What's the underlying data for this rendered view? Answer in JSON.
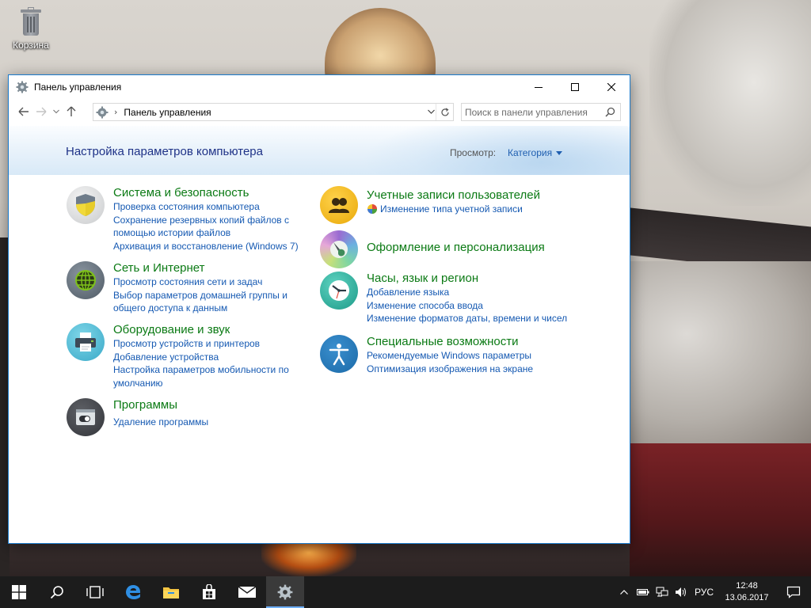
{
  "desktop": {
    "recycle_bin_label": "Корзина"
  },
  "window": {
    "title": "Панель управления",
    "address": {
      "crumb": "Панель управления",
      "separator": "›"
    },
    "search": {
      "placeholder": "Поиск в панели управления"
    },
    "banner": {
      "heading": "Настройка параметров компьютера",
      "view_label": "Просмотр:",
      "view_value": "Категория"
    },
    "categories": [
      {
        "title": "Система и безопасность",
        "icon": "shield-icon",
        "links": [
          "Проверка состояния компьютера",
          "Сохранение резервных копий файлов с помощью истории файлов",
          "Архивация и восстановление (Windows 7)"
        ]
      },
      {
        "title": "Сеть и Интернет",
        "icon": "globe-icon",
        "links": [
          "Просмотр состояния сети и задач",
          "Выбор параметров домашней группы и общего доступа к данным"
        ]
      },
      {
        "title": "Оборудование и звук",
        "icon": "printer-icon",
        "links": [
          "Просмотр устройств и принтеров",
          "Добавление устройства",
          "Настройка параметров мобильности по умолчанию"
        ]
      },
      {
        "title": "Программы",
        "icon": "programs-icon",
        "links": [
          "Удаление программы"
        ]
      },
      {
        "title": "Учетные записи пользователей",
        "icon": "users-icon",
        "links": [
          "Изменение типа учетной записи"
        ]
      },
      {
        "title": "Оформление и персонализация",
        "icon": "paintbrush-icon",
        "links": []
      },
      {
        "title": "Часы, язык и регион",
        "icon": "clock-icon",
        "links": [
          "Добавление языка",
          "Изменение способа ввода",
          "Изменение форматов даты, времени и чисел"
        ]
      },
      {
        "title": "Специальные возможности",
        "icon": "accessibility-icon",
        "links": [
          "Рекомендуемые Windows параметры",
          "Оптимизация изображения на экране"
        ]
      }
    ],
    "link_lines": {
      "sys_backup_1": "Сохранение резервных копий файлов с",
      "sys_backup_2": "помощью истории файлов",
      "net_home_1": "Выбор параметров домашней группы и",
      "net_home_2": "общего доступа к данным",
      "hw_mobility_1": "Настройка параметров мобильности по",
      "hw_mobility_2": "умолчанию"
    }
  },
  "taskbar": {
    "apps": [
      "start-icon",
      "search-icon",
      "task-view-icon",
      "edge-icon",
      "file-explorer-icon",
      "store-icon",
      "mail-icon",
      "control-panel-icon"
    ],
    "tray": {
      "language": "РУС",
      "time": "12:48",
      "date": "13.06.2017"
    }
  },
  "colors": {
    "link": "#1559b2",
    "category_title": "#0b7a14",
    "heading": "#1e3287",
    "window_border": "#1979ca",
    "taskbar": "#1c1c1c"
  }
}
